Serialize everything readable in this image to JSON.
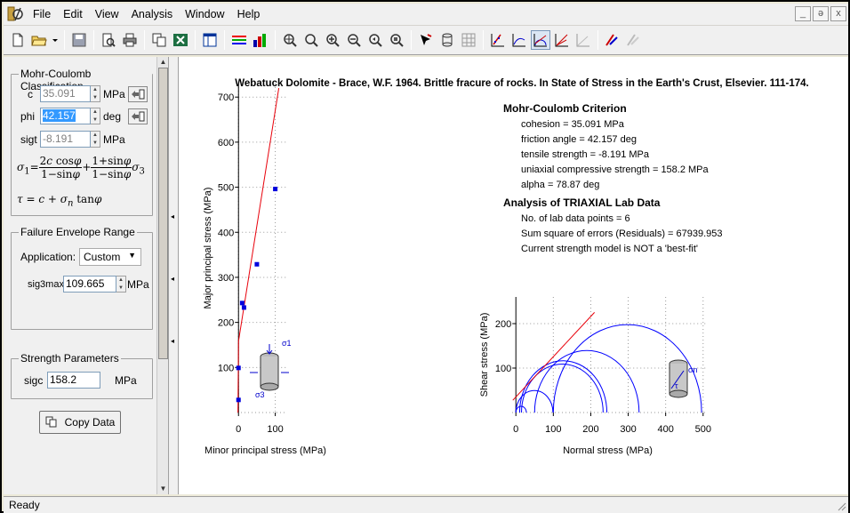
{
  "menu": [
    "File",
    "Edit",
    "View",
    "Analysis",
    "Window",
    "Help"
  ],
  "window_controls": [
    "_",
    "ǝ",
    "x"
  ],
  "left": {
    "mc_group": {
      "title": "Mohr-Coulomb Classification",
      "c": {
        "label": "c",
        "value": "35.091",
        "unit": "MPa"
      },
      "phi": {
        "label": "phi",
        "value": "42.157",
        "unit": "deg"
      },
      "sigt": {
        "label": "sigt",
        "value": "-8.191",
        "unit": "MPa"
      }
    },
    "envelope_group": {
      "title": "Failure Envelope Range",
      "application_label": "Application:",
      "application_value": "Custom",
      "sig3max_label": "sig3max",
      "sig3max_value": "109.665",
      "sig3max_unit": "MPa"
    },
    "strength_group": {
      "title": "Strength Parameters",
      "sigc_label": "sigc",
      "sigc_value": "158.2",
      "sigc_unit": "MPa"
    },
    "copy_button": "Copy Data"
  },
  "report": {
    "title": "Webatuck Dolomite - Brace, W.F. 1964. Brittle fracure of rocks. In State of Stress in the Earth's Crust, Elsevier. 111-174.",
    "criterion_heading": "Mohr-Coulomb Criterion",
    "criterion_lines": [
      "cohesion = 35.091 MPa",
      "friction angle = 42.157 deg",
      "tensile strength = -8.191 MPa",
      "uniaxial compressive strength = 158.2 MPa",
      "alpha = 78.87 deg"
    ],
    "analysis_heading": "Analysis of TRIAXIAL Lab Data",
    "analysis_lines": [
      "No. of lab data points = 6",
      "Sum square of errors (Residuals) = 67939.953",
      "Current strength model is NOT a 'best-fit'"
    ]
  },
  "status": "Ready",
  "colors": {
    "envelope_line": "#e8000a",
    "data_points": "#0000dd",
    "mohr_circles": "#0000ff",
    "selection": "#3399ff"
  },
  "chart_data": [
    {
      "type": "scatter",
      "title": "",
      "xlabel": "Minor principal stress (MPa)",
      "ylabel": "Major principal stress (MPa)",
      "xlim": [
        -3,
        130
      ],
      "ylim": [
        0,
        730
      ],
      "xticks": [
        0,
        100
      ],
      "yticks": [
        100,
        200,
        300,
        400,
        500,
        600,
        700
      ],
      "grid": true,
      "series": [
        {
          "values": [
            {
              "x": 0,
              "y": 28
            },
            {
              "x": 0,
              "y": 99
            },
            {
              "x": 10,
              "y": 243
            },
            {
              "x": 15,
              "y": 233
            },
            {
              "x": 50,
              "y": 329
            },
            {
              "x": 100,
              "y": 496
            }
          ]
        },
        {
          "type": "line",
          "values": [
            {
              "x": -1.5,
              "y": 0
            },
            {
              "x": 0,
              "y": 158.2
            },
            {
              "x": 109.665,
              "y": 720
            }
          ]
        }
      ],
      "inset_labels": [
        "σ1",
        "σ3"
      ]
    },
    {
      "type": "line",
      "title": "",
      "xlabel": "Normal stress (MPa)",
      "ylabel": "Shear stress (MPa)",
      "xlim": [
        -10,
        510
      ],
      "ylim": [
        0,
        260
      ],
      "xticks": [
        0,
        100,
        200,
        300,
        400,
        500
      ],
      "yticks": [
        100,
        200
      ],
      "grid": true,
      "circles": [
        {
          "sigma3": 0,
          "sigma1": 28
        },
        {
          "sigma3": 0,
          "sigma1": 99
        },
        {
          "sigma3": 10,
          "sigma1": 243
        },
        {
          "sigma3": 15,
          "sigma1": 233
        },
        {
          "sigma3": 50,
          "sigma1": 329
        },
        {
          "sigma3": 100,
          "sigma1": 496
        }
      ],
      "envelope": {
        "cohesion": 35.091,
        "friction_angle": 42.157,
        "sigma_range": [
          -8.191,
          210
        ]
      },
      "inset_labels": [
        "σn",
        "τ"
      ]
    }
  ]
}
